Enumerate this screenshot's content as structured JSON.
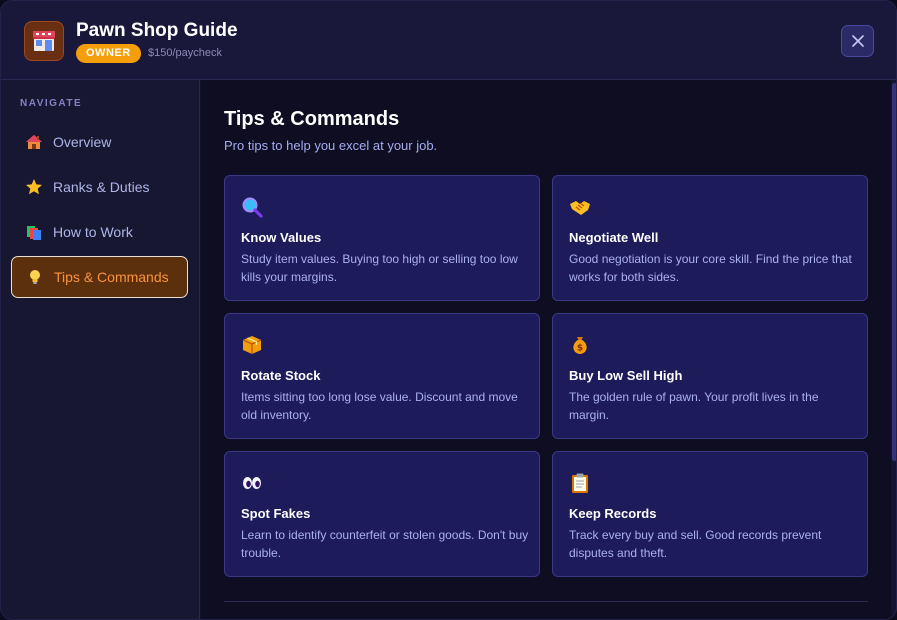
{
  "header": {
    "title": "Pawn Shop Guide",
    "badge": "OWNER",
    "pay": "$150/paycheck",
    "app_icon": "pawn-shop-icon",
    "close_icon": "close-icon"
  },
  "sidebar": {
    "label": "NAVIGATE",
    "items": [
      {
        "label": "Overview",
        "icon": "house-icon",
        "active": false
      },
      {
        "label": "Ranks & Duties",
        "icon": "star-icon",
        "active": false
      },
      {
        "label": "How to Work",
        "icon": "books-icon",
        "active": false
      },
      {
        "label": "Tips & Commands",
        "icon": "lightbulb-icon",
        "active": true
      }
    ]
  },
  "main": {
    "title": "Tips & Commands",
    "subtitle": "Pro tips to help you excel at your job.",
    "cards": [
      {
        "title": "Know Values",
        "desc": "Study item values. Buying too high or selling too low kills your margins.",
        "icon": "magnifier-icon"
      },
      {
        "title": "Negotiate Well",
        "desc": "Good negotiation is your core skill. Find the price that works for both sides.",
        "icon": "handshake-icon"
      },
      {
        "title": "Rotate Stock",
        "desc": "Items sitting too long lose value. Discount and move old inventory.",
        "icon": "package-icon"
      },
      {
        "title": "Buy Low Sell High",
        "desc": "The golden rule of pawn. Your profit lives in the margin.",
        "icon": "money-bag-icon"
      },
      {
        "title": "Spot Fakes",
        "desc": "Learn to identify counterfeit or stolen goods. Don't buy trouble.",
        "icon": "eyes-icon"
      },
      {
        "title": "Keep Records",
        "desc": "Track every buy and sell. Good records prevent disputes and theft.",
        "icon": "clipboard-icon"
      }
    ]
  },
  "colors": {
    "accent": "#f59e0b",
    "active_text": "#fb923c",
    "card_bg": "#1e1b5b",
    "background": "#0e0d22"
  }
}
